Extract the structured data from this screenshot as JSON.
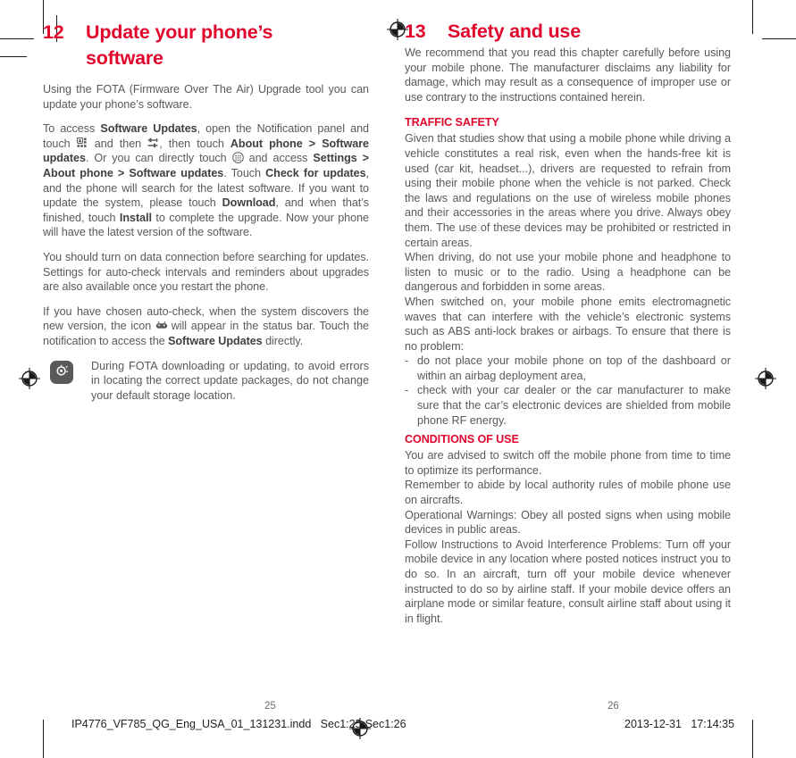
{
  "document": {
    "left_page": {
      "chapter": {
        "number": "12",
        "title_line1": "Update your phone’s",
        "title_line2": "software"
      },
      "paragraphs": [
        "Using the FOTA (Firmware Over The Air) Upgrade tool you can update your phone’s software.",
        "To access Software Updates, open the Notification panel and touch [icon:apps-grid] and then [icon:settings-sliders], then touch About phone > Software updates. Or you can directly touch [icon:app-drawer] and access Settings > About phone > Software updates. Touch Check for updates, and the phone will search for the latest software. If you want to update the system, please touch Download, and when that’s finished, touch Install to complete the upgrade. Now your phone will have the latest version of the software.",
        "You should turn on data connection before searching for updates. Settings for auto-check intervals and reminders about upgrades are also available once you restart the phone.",
        "If you have chosen auto-check, when the system discovers the new version, the  icon [icon:android-robot] will appear in the status bar. Touch the notification to access the Software Updates directly."
      ],
      "para2_segments": [
        {
          "t": "To access ",
          "b": false
        },
        {
          "t": "Software Updates",
          "b": true
        },
        {
          "t": ", open the Notification panel and touch ",
          "b": false
        },
        {
          "t": "[icon:apps-grid]",
          "b": false
        },
        {
          "t": " and then ",
          "b": false
        },
        {
          "t": "[icon:settings-sliders]",
          "b": false
        },
        {
          "t": ", then touch ",
          "b": false
        },
        {
          "t": "About phone > Software updates",
          "b": true
        },
        {
          "t": ". Or you can directly touch ",
          "b": false
        },
        {
          "t": "[icon:app-drawer]",
          "b": false
        },
        {
          "t": " and access ",
          "b": false
        },
        {
          "t": "Settings > About phone > Software updates",
          "b": true
        },
        {
          "t": ". Touch ",
          "b": false
        },
        {
          "t": "Check for updates",
          "b": true
        },
        {
          "t": ", and the phone will search for the latest software. If you want to update the system, please touch ",
          "b": false
        },
        {
          "t": "Download",
          "b": true
        },
        {
          "t": ", and when that’s finished, touch ",
          "b": false
        },
        {
          "t": "Install",
          "b": true
        },
        {
          "t": " to complete the upgrade. Now your phone will have the latest version of the software.",
          "b": false
        }
      ],
      "note": {
        "icon_name": "tip-lightbulb-icon",
        "text": "During FOTA downloading or updating, to avoid errors in locating the correct update packages, do not change your default storage location."
      },
      "folio": "25"
    },
    "right_page": {
      "chapter": {
        "number": "13",
        "title": "Safety and use"
      },
      "intro": "We recommend that you read this chapter carefully before using your mobile phone. The manufacturer disclaims any liability for damage, which may result as a consequence of improper use or use contrary to the instructions contained herein.",
      "sections": [
        {
          "heading": "TRAFFIC SAFETY",
          "paragraphs": [
            "Given that studies show that using a mobile phone while driving a vehicle constitutes a real risk, even when the hands-free kit is used (car kit, headset...), drivers are requested to refrain from using their mobile phone when the vehicle is not parked. Check the laws and regulations on the use of wireless mobile phones and their accessories in the areas where you drive. Always obey them. The use of these devices may be prohibited or restricted in certain areas.",
            "When driving, do not use your mobile phone and headphone to listen to music or to the radio. Using a headphone can be dangerous and forbidden in some areas.",
            "When switched on, your mobile phone emits electromagnetic waves that can interfere with the vehicle’s electronic systems such as ABS anti-lock brakes or airbags. To ensure that there is no problem:"
          ],
          "bullets": [
            "do not place your mobile phone on top of the dashboard or within an airbag deployment area,",
            "check with your car dealer or the car manufacturer to make sure that the car’s electronic devices are shielded from mobile phone RF energy."
          ]
        },
        {
          "heading": "CONDITIONS OF USE",
          "paragraphs": [
            "You are advised to switch off the mobile phone from time to time to optimize its performance.",
            "Remember to abide by local authority rules of mobile phone use on aircrafts.",
            "Operational Warnings: Obey all posted signs when using mobile devices in public areas.",
            "Follow Instructions to Avoid Interference Problems: Turn off your mobile device in any location where posted notices instruct you to do so. In an aircraft, turn off your mobile device whenever instructed to do so by airline staff. If your mobile device offers an airplane mode or similar feature, consult airline staff about using it in flight."
          ],
          "bullets": []
        }
      ],
      "folio": "26"
    }
  },
  "printer_marks": {
    "file_name": "IP4776_VF785_QG_Eng_USA_01_131231.indd   Sec1:25-Sec1:26",
    "timestamp": "2013-12-31   17:14:35"
  },
  "colors": {
    "accent_red": "#e1062c",
    "body_gray": "#58595b",
    "mark_black": "#1a1a1a"
  }
}
